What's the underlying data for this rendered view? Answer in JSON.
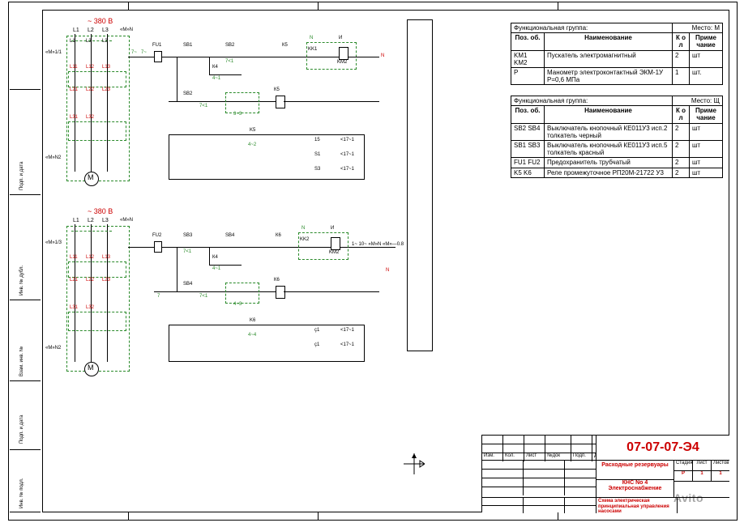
{
  "power_label": "~ 380 В",
  "phase_labels": [
    "L1",
    "L2",
    "L3"
  ],
  "phase_sub": [
    "L1",
    "L3",
    "L3"
  ],
  "neutral_in": "«M»N",
  "circuit1": {
    "left_in_top": "«M»1/1",
    "left_in_bot": "«M»N2",
    "motor": "M 1~",
    "contactor_labels": [
      "L11",
      "L12",
      "L13",
      "L21",
      "L22",
      "L23",
      "L31",
      "L32"
    ],
    "bus_nodes": [
      "7~",
      "7~"
    ],
    "top_line": {
      "fuse": "FU1",
      "sb": "SB1",
      "sb2": "SB2",
      "sb2_node": "7<1",
      "k": "К5",
      "kk1": "KK1",
      "km2": "KM2",
      "neutral": "N",
      "kk_icon": "И"
    },
    "k_branch": {
      "k": "К4",
      "node": "4~1"
    },
    "sb2_branch": {
      "sb": "SB2",
      "node": "7<1",
      "green_node": "3~3",
      "k": "К5"
    },
    "strip": {
      "k": "K5",
      "green": "4~2",
      "rows": [
        {
          "l": "15",
          "r": "<17~1"
        },
        {
          "l": "S1",
          "r": "<17~1"
        },
        {
          "l": "S3",
          "r": "<17~1"
        }
      ]
    }
  },
  "circuit2": {
    "left_in_top": "«M»1/3",
    "left_in_bot": "«M»N2",
    "motor": "M 1~",
    "top_line": {
      "fuse": "FU2",
      "sb": "SB3",
      "sb_node": "7<1",
      "sb4": "SB4",
      "k": "К6",
      "kk2": "KK2",
      "km2": "KM2",
      "neutral": "N",
      "kk_icon": "И",
      "tail": "1~  10~  «M»N «M»—0.8"
    },
    "k_branch": {
      "k": "К4",
      "node": "4~1"
    },
    "sb4_branch": {
      "sb": "SB4",
      "node1": "7",
      "node2": "7<1",
      "green": "4~3",
      "k": "К6"
    },
    "strip": {
      "k": "K6",
      "green": "4~4",
      "rows": [
        {
          "l": "ç1",
          "r": "<17~1"
        },
        {
          "l": "ç1",
          "r": "<17~1"
        }
      ]
    }
  },
  "tables": {
    "group_M": {
      "title_l": "Функциональная группа:",
      "title_r": "Место: М",
      "head": [
        "Поз. об.",
        "Наименование",
        "К о л",
        "Приме чание"
      ],
      "rows": [
        {
          "pos": "KM1 KM2",
          "name": "Пускатель электромагнитный",
          "qty": "2",
          "note": "шт"
        },
        {
          "pos": "Р",
          "name": "Манометр электроконтактный ЭКМ-1У Р=0,6 МПа",
          "qty": "1",
          "note": "шт."
        }
      ]
    },
    "group_Sh": {
      "title_l": "Функциональная группа:",
      "title_r": "Место: Щ",
      "head": [
        "Поз. об.",
        "Наименование",
        "К о л",
        "Приме чание"
      ],
      "rows": [
        {
          "pos": "SB2 SB4",
          "name": "Выключатель кнопочный КЕ011У3 исп.2 толкатель черный",
          "qty": "2",
          "note": "шт"
        },
        {
          "pos": "SB1 SB3",
          "name": "Выключатель кнопочный КЕ011У3 исп.5 толкатель красный",
          "qty": "2",
          "note": "шт"
        },
        {
          "pos": "FU1 FU2",
          "name": "Предохранитель трубчатый",
          "qty": "2",
          "note": "шт"
        },
        {
          "pos": "K5 K6",
          "name": "Реле промежуточное РП20М-21722 У3",
          "qty": "2",
          "note": "шт"
        }
      ]
    }
  },
  "titleblock": {
    "doc_no": "07-07-07-Э4",
    "line1": "Расходные резервуары",
    "owner": "КНС No 4",
    "type": "Электроснабжение",
    "bottom": "Схема электрическая принципиальная управления насосами",
    "small_cells": [
      "Изм.",
      "Кол.",
      "Лист",
      "№док",
      "Подп.",
      "Дата"
    ],
    "right_cells": [
      "Стадия",
      "Лист",
      "Листов"
    ],
    "right_vals": [
      "Р",
      "1",
      "1"
    ]
  },
  "watermark": "Avito",
  "binding_labels": [
    "Инв. № подл.",
    "Подп. и дата",
    "Взам. инв. №",
    "Инв. № дубл.",
    "Подп. и дата"
  ]
}
